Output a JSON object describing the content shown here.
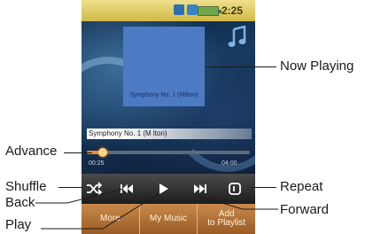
{
  "status_bar": {
    "clock": "2:25",
    "icons": [
      "signal-icon",
      "bluetooth-icon",
      "music-icon",
      "battery-icon"
    ]
  },
  "player": {
    "album_caption": "Symphony No. 1 (Milton)",
    "track_title": "Symphony No. 1 (M lton)",
    "elapsed": "00:25",
    "total": "04:00",
    "progress": 0.1
  },
  "controls": {
    "shuffle": "shuffle-icon",
    "back": "back-icon",
    "play": "play-icon",
    "forward": "forward-icon",
    "repeat": "repeat-icon"
  },
  "softkeys": {
    "more": "More",
    "my_music": "My Music",
    "add_line1": "Add",
    "add_line2": "to Playlist"
  },
  "callouts": {
    "now_playing": "Now Playing",
    "advance": "Advance",
    "shuffle": "Shuffle",
    "back": "Back",
    "play": "Play",
    "repeat": "Repeat",
    "forward": "Forward"
  },
  "colors": {
    "accent": "#f28c2a",
    "softkey_bar": "#b5753b",
    "album_art": "#4d7bc3",
    "status_bar": "#e3cf6a"
  }
}
